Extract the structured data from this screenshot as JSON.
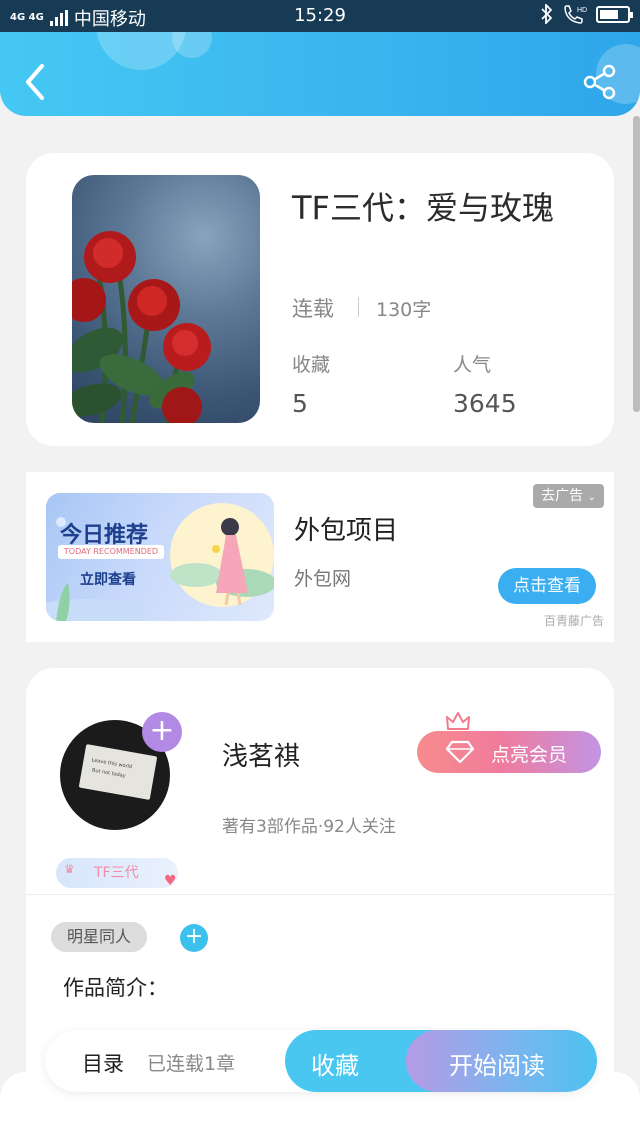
{
  "status_bar": {
    "network": "4G 4G",
    "carrier": "中国移动",
    "time": "15:29"
  },
  "header": {
    "back_icon": "chevron-left-icon",
    "share_icon": "share-icon",
    "color": "#3ab6ef"
  },
  "book": {
    "title": "TF三代：爱与玫瑰",
    "status": "连载",
    "word_count": "130字",
    "favorites_label": "收藏",
    "favorites_value": "5",
    "popularity_label": "人气",
    "popularity_value": "3645"
  },
  "ad": {
    "banner_title": "今日推荐",
    "banner_subtitle": "TODAY RECOMMENDED",
    "banner_cta": "立即查看",
    "title": "外包项目",
    "subtitle": "外包网",
    "remove_label": "去广告",
    "cta_label": "点击查看",
    "source": "百青藤广告"
  },
  "author": {
    "name": "浅茗祺",
    "stats": "著有3部作品·92人关注",
    "vip_label": "点亮会员",
    "fan_tag": "TF三代",
    "category_tag": "明星同人",
    "intro_label": "作品简介："
  },
  "bottom_bar": {
    "toc_label": "目录",
    "toc_status": "已连载1章",
    "collect_label": "收藏",
    "read_label": "开始阅读"
  }
}
